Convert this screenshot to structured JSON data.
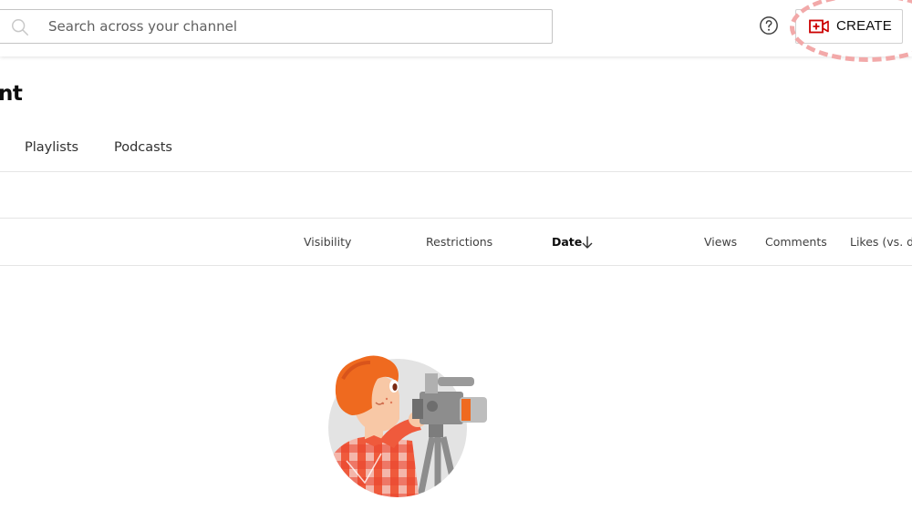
{
  "header": {
    "search": {
      "placeholder": "Search across your channel",
      "value": ""
    },
    "help_icon": "help-circle-icon",
    "create_button": {
      "label": "CREATE",
      "icon": "video-plus-icon",
      "accent": "#cc0000"
    }
  },
  "page": {
    "title_fragment": "nt"
  },
  "tabs": [
    {
      "label": "Playlists"
    },
    {
      "label": "Podcasts"
    }
  ],
  "table": {
    "columns": [
      {
        "label": "Visibility"
      },
      {
        "label": "Restrictions"
      },
      {
        "label": "Date",
        "sorted": "descending"
      },
      {
        "label": "Views"
      },
      {
        "label": "Comments"
      },
      {
        "label": "Likes (vs. di"
      }
    ]
  },
  "empty_state": {
    "illustration": "videographer-illustration"
  },
  "colors": {
    "highlight_ring": "#f2a9a9",
    "brand_red": "#cc0000",
    "divider": "#e5e5e5"
  }
}
